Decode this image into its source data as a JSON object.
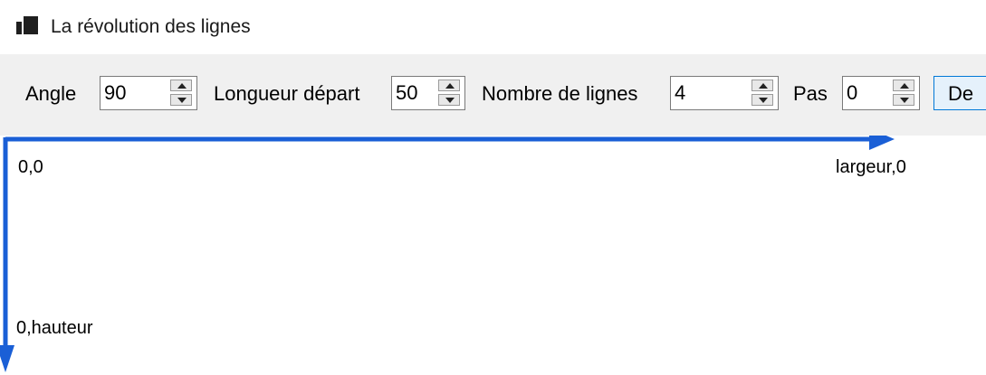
{
  "window": {
    "title": "La révolution des lignes",
    "icon": "app-window-icon"
  },
  "toolbar": {
    "angle_label": "Angle",
    "angle_value": "90",
    "length_label": "Longueur départ",
    "length_value": "50",
    "lines_label": "Nombre de lignes",
    "lines_value": "4",
    "step_label": "Pas",
    "step_value": "0",
    "draw_button_label": "De"
  },
  "canvas": {
    "origin_label": "0,0",
    "width_label": "largeur,0",
    "height_label": "0,hauteur",
    "arrow_color": "#1a5fd6"
  }
}
